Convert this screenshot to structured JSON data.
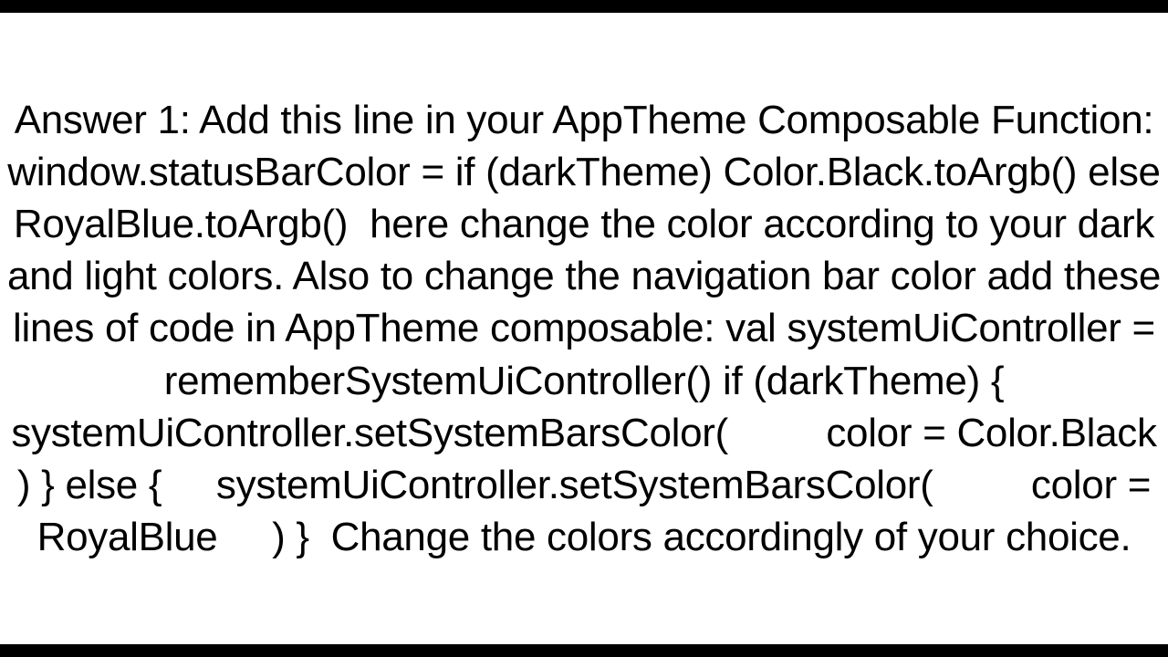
{
  "answer": {
    "text": "Answer 1: Add this line in your AppTheme Composable Function: window.statusBarColor = if (darkTheme) Color.Black.toArgb() else RoyalBlue.toArgb()  here change the color according to your dark and light colors. Also to change the navigation bar color add these lines of code in AppTheme composable: val systemUiController = rememberSystemUiController() if (darkTheme) {     systemUiController.setSystemBarsColor(         color = Color.Black     ) } else {     systemUiController.setSystemBarsColor(         color = RoyalBlue     ) }  Change the colors accordingly of your choice."
  }
}
